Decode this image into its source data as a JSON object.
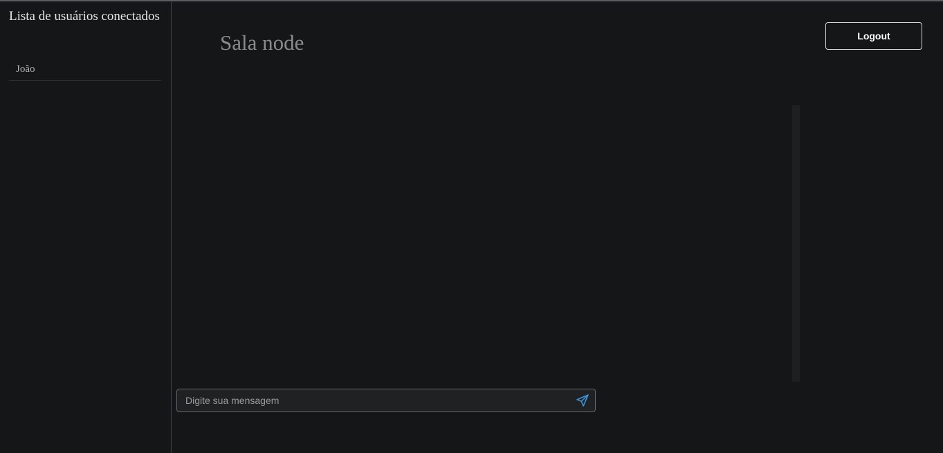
{
  "sidebar": {
    "title": "Lista de usuários conectados",
    "users": [
      {
        "name": "João"
      }
    ]
  },
  "main": {
    "room_title": "Sala node",
    "logout_label": "Logout",
    "message_input": {
      "value": "",
      "placeholder": "Digite sua mensagem"
    },
    "send_icon": "paper-plane-icon"
  },
  "colors": {
    "background": "#151618",
    "send_icon": "#3b8fd6",
    "room_title": "#8a8b8d"
  }
}
